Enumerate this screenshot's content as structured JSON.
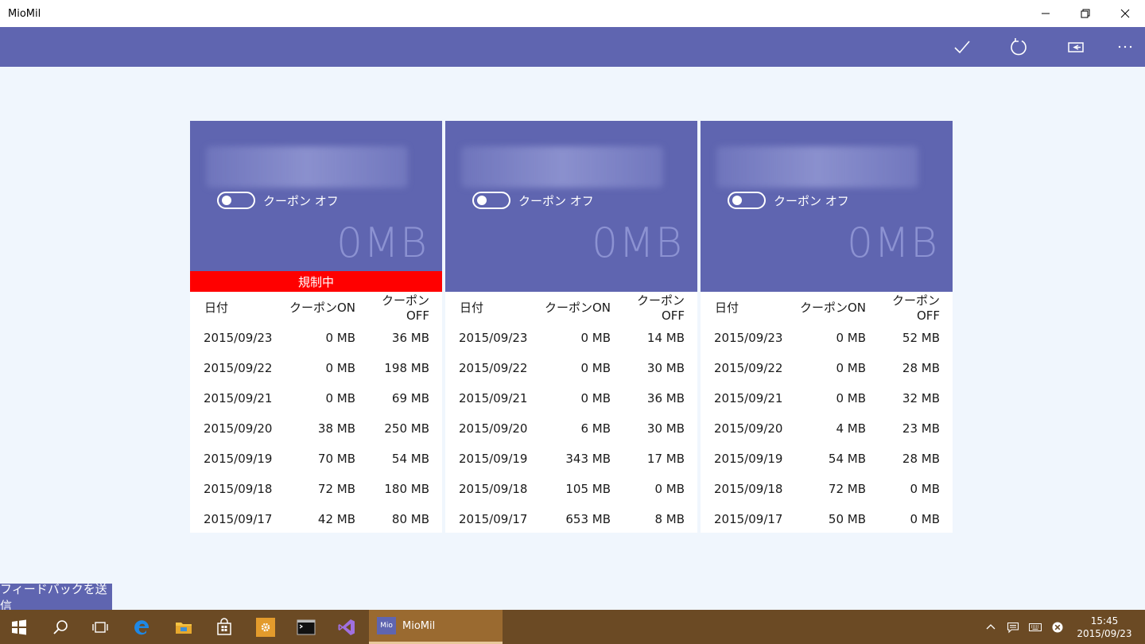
{
  "window": {
    "title": "MioMil"
  },
  "appbar": {
    "buttons": [
      {
        "icon": "checkmark-icon"
      },
      {
        "icon": "refresh-icon"
      },
      {
        "icon": "sim-card-icon"
      },
      {
        "icon": "more-icon",
        "label": "···"
      }
    ]
  },
  "colors": {
    "accent": "#5f65b0",
    "restricted": "#ff0000",
    "taskbar": "#6b4a24"
  },
  "cards": [
    {
      "coupon_label": "クーポン オフ",
      "coupon_on": false,
      "usage": "0MB",
      "restricted_label": "規制中",
      "restricted": true,
      "headers": {
        "date": "日付",
        "coupon_on": "クーポンON",
        "coupon_off": "クーポンOFF"
      },
      "rows": [
        {
          "date": "2015/09/23",
          "on": "0 MB",
          "off": "36 MB"
        },
        {
          "date": "2015/09/22",
          "on": "0 MB",
          "off": "198 MB"
        },
        {
          "date": "2015/09/21",
          "on": "0 MB",
          "off": "69 MB"
        },
        {
          "date": "2015/09/20",
          "on": "38 MB",
          "off": "250 MB"
        },
        {
          "date": "2015/09/19",
          "on": "70 MB",
          "off": "54 MB"
        },
        {
          "date": "2015/09/18",
          "on": "72 MB",
          "off": "180 MB"
        },
        {
          "date": "2015/09/17",
          "on": "42 MB",
          "off": "80 MB"
        }
      ]
    },
    {
      "coupon_label": "クーポン オフ",
      "coupon_on": false,
      "usage": "0MB",
      "restricted_label": "",
      "restricted": false,
      "headers": {
        "date": "日付",
        "coupon_on": "クーポンON",
        "coupon_off": "クーポンOFF"
      },
      "rows": [
        {
          "date": "2015/09/23",
          "on": "0 MB",
          "off": "14 MB"
        },
        {
          "date": "2015/09/22",
          "on": "0 MB",
          "off": "30 MB"
        },
        {
          "date": "2015/09/21",
          "on": "0 MB",
          "off": "36 MB"
        },
        {
          "date": "2015/09/20",
          "on": "6 MB",
          "off": "30 MB"
        },
        {
          "date": "2015/09/19",
          "on": "343 MB",
          "off": "17 MB"
        },
        {
          "date": "2015/09/18",
          "on": "105 MB",
          "off": "0 MB"
        },
        {
          "date": "2015/09/17",
          "on": "653 MB",
          "off": "8 MB"
        }
      ]
    },
    {
      "coupon_label": "クーポン オフ",
      "coupon_on": false,
      "usage": "0MB",
      "restricted_label": "",
      "restricted": false,
      "headers": {
        "date": "日付",
        "coupon_on": "クーポンON",
        "coupon_off": "クーポンOFF"
      },
      "rows": [
        {
          "date": "2015/09/23",
          "on": "0 MB",
          "off": "52 MB"
        },
        {
          "date": "2015/09/22",
          "on": "0 MB",
          "off": "28 MB"
        },
        {
          "date": "2015/09/21",
          "on": "0 MB",
          "off": "32 MB"
        },
        {
          "date": "2015/09/20",
          "on": "4 MB",
          "off": "23 MB"
        },
        {
          "date": "2015/09/19",
          "on": "54 MB",
          "off": "28 MB"
        },
        {
          "date": "2015/09/18",
          "on": "72 MB",
          "off": "0 MB"
        },
        {
          "date": "2015/09/17",
          "on": "50 MB",
          "off": "0 MB"
        }
      ]
    }
  ],
  "feedback": {
    "label": "フィードバックを送信"
  },
  "taskbar": {
    "pinned": [
      "start-icon",
      "search-icon",
      "task-view-icon",
      "edge-icon",
      "file-explorer-icon",
      "store-icon",
      "settings-app-icon",
      "terminal-icon",
      "visual-studio-icon"
    ],
    "active_app": {
      "badge": "Mio",
      "label": "MioMil"
    },
    "tray": [
      "chevron-up-icon",
      "action-center-icon",
      "keyboard-icon",
      "network-icon"
    ],
    "time": "15:45",
    "date": "2015/09/23"
  }
}
